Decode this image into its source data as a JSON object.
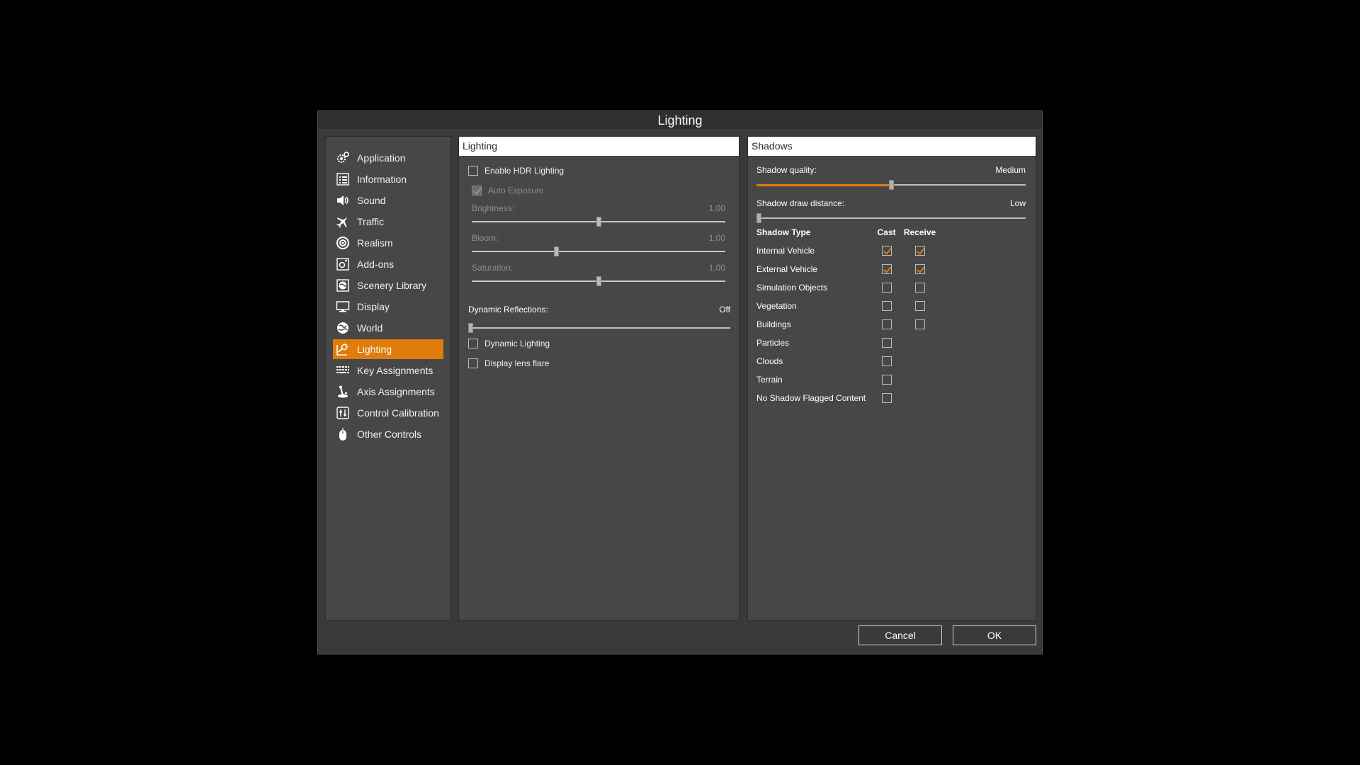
{
  "dialog": {
    "title": "Lighting"
  },
  "sidebar": {
    "items": [
      {
        "label": "Application",
        "icon": "gear-icon",
        "active": false
      },
      {
        "label": "Information",
        "icon": "list-icon",
        "active": false
      },
      {
        "label": "Sound",
        "icon": "speaker-icon",
        "active": false
      },
      {
        "label": "Traffic",
        "icon": "airplane-icon",
        "active": false
      },
      {
        "label": "Realism",
        "icon": "target-icon",
        "active": false
      },
      {
        "label": "Add-ons",
        "icon": "addon-icon",
        "active": false
      },
      {
        "label": "Scenery Library",
        "icon": "globe-box-icon",
        "active": false
      },
      {
        "label": "Display",
        "icon": "monitor-icon",
        "active": false
      },
      {
        "label": "World",
        "icon": "globe-icon",
        "active": false
      },
      {
        "label": "Lighting",
        "icon": "lighting-icon",
        "active": true
      },
      {
        "label": "Key Assignments",
        "icon": "keyboard-icon",
        "active": false
      },
      {
        "label": "Axis Assignments",
        "icon": "joystick-icon",
        "active": false
      },
      {
        "label": "Control Calibration",
        "icon": "sliders-icon",
        "active": false
      },
      {
        "label": "Other Controls",
        "icon": "mouse-icon",
        "active": false
      }
    ]
  },
  "lighting": {
    "header": "Lighting",
    "enable_hdr": {
      "label": "Enable HDR Lighting",
      "checked": false
    },
    "auto_exposure": {
      "label": "Auto Exposure",
      "checked": true,
      "disabled": true
    },
    "brightness": {
      "label": "Brightness:",
      "value": "1,00",
      "fraction": 0.5
    },
    "bloom": {
      "label": "Bloom:",
      "value": "1,00",
      "fraction": 0.33
    },
    "saturation": {
      "label": "Saturation:",
      "value": "1,00",
      "fraction": 0.5
    },
    "dynamic_reflections": {
      "label": "Dynamic Reflections:",
      "value": "Off",
      "fraction": 0.0
    },
    "dynamic_lighting": {
      "label": "Dynamic Lighting",
      "checked": false
    },
    "lens_flare": {
      "label": "Display lens flare",
      "checked": false
    }
  },
  "shadows": {
    "header": "Shadows",
    "quality": {
      "label": "Shadow quality:",
      "value": "Medium",
      "fraction": 0.5
    },
    "draw_distance": {
      "label": "Shadow draw distance:",
      "value": "Low",
      "fraction": 0.0
    },
    "columns": {
      "type": "Shadow Type",
      "cast": "Cast",
      "receive": "Receive"
    },
    "rows": [
      {
        "name": "Internal Vehicle",
        "cast": true,
        "receive": true
      },
      {
        "name": "External Vehicle",
        "cast": true,
        "receive": true
      },
      {
        "name": "Simulation Objects",
        "cast": false,
        "receive": false
      },
      {
        "name": "Vegetation",
        "cast": false,
        "receive": false
      },
      {
        "name": "Buildings",
        "cast": false,
        "receive": false
      },
      {
        "name": "Particles",
        "cast": false,
        "receive": null
      },
      {
        "name": "Clouds",
        "cast": false,
        "receive": null
      },
      {
        "name": "Terrain",
        "cast": false,
        "receive": null
      },
      {
        "name": "No Shadow Flagged Content",
        "cast": false,
        "receive": null
      }
    ]
  },
  "buttons": {
    "cancel": "Cancel",
    "ok": "OK"
  },
  "colors": {
    "accent": "#e07b0c",
    "panel": "#474747",
    "dialog": "#3a3a3a"
  }
}
